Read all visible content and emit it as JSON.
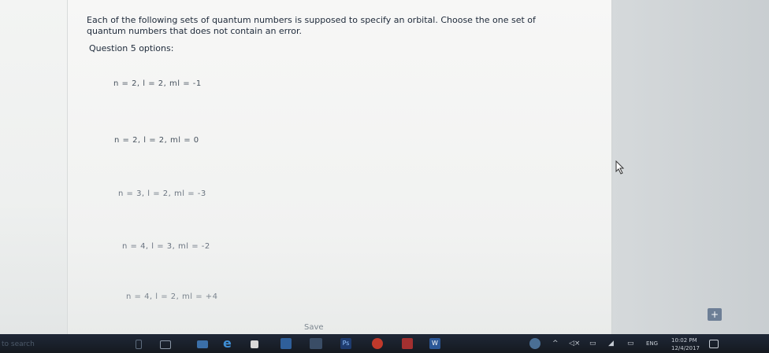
{
  "question": {
    "text": "Each of the following sets of quantum numbers is supposed to specify an orbital. Choose the one set of quantum numbers that does not contain an error.",
    "options_label": "Question 5 options:"
  },
  "options": [
    "n = 2, l = 2, ml = -1",
    "n = 2, l = 2, ml = 0",
    "n = 3, l = 2, ml = -3",
    "n = 4, l = 3, ml = -2",
    "n = 4, l = 2, ml = +4"
  ],
  "save_label": "Save",
  "taskbar": {
    "search_text": "to search",
    "language": "ENG",
    "time": "10:02 PM",
    "date": "12/4/2017"
  },
  "colors": {
    "taskbar": "#1a1f27",
    "float_button": "#6d7f96",
    "ps_icon": "#1e3b6e",
    "word_icon": "#2b5797"
  }
}
